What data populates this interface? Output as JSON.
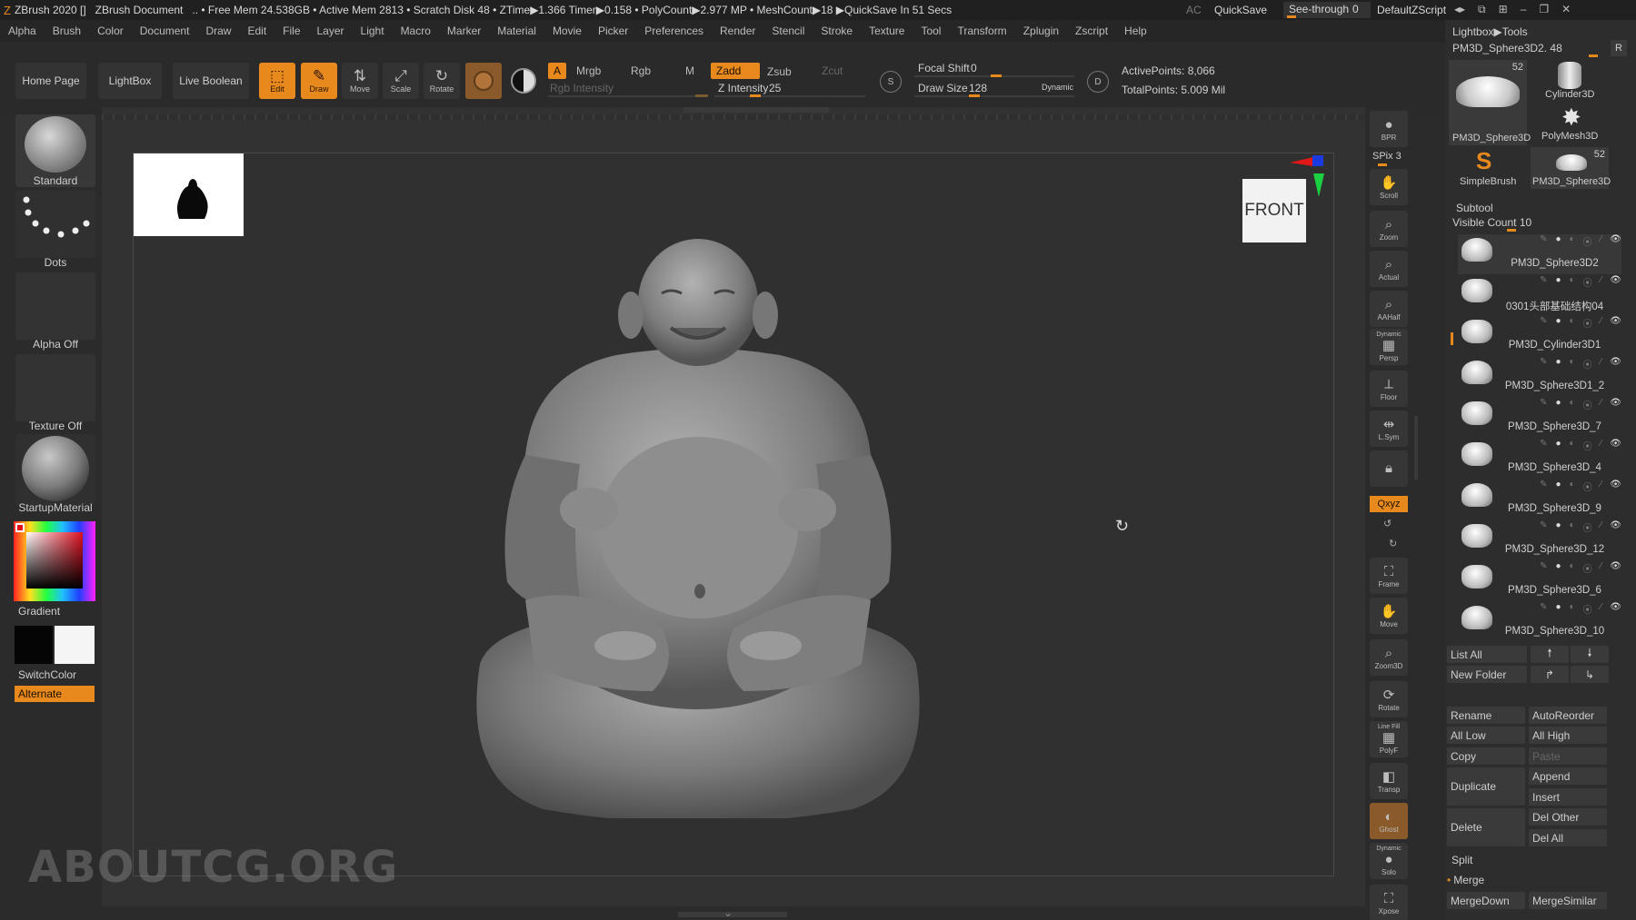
{
  "titlebar": {
    "app": "ZBrush 2020 []",
    "document": "ZBrush Document",
    "stats": ".. • Free Mem 24.538GB • Active Mem 2813 • Scratch Disk 48 • ZTime▶1.366 Timer▶0.158 • PolyCount▶2.977 MP • MeshCount▶18 ▶QuickSave In 51 Secs",
    "ac": "AC",
    "quicksave": "QuickSave",
    "seethrough": "See-through",
    "seethrough_value": "0",
    "script": "DefaultZScript"
  },
  "menubar": [
    "Alpha",
    "Brush",
    "Color",
    "Document",
    "Draw",
    "Edit",
    "File",
    "Layer",
    "Light",
    "Macro",
    "Marker",
    "Material",
    "Movie",
    "Picker",
    "Preferences",
    "Render",
    "Stencil",
    "Stroke",
    "Texture",
    "Tool",
    "Transform",
    "Zplugin",
    "Zscript",
    "Help"
  ],
  "toolbar": {
    "home_page": "Home Page",
    "lightbox": "LightBox",
    "live_boolean": "Live Boolean",
    "edit": "Edit",
    "draw": "Draw",
    "move": "Move",
    "scale": "Scale",
    "rotate": "Rotate",
    "a": "A",
    "mrgb": "Mrgb",
    "rgb": "Rgb",
    "m": "M",
    "zadd": "Zadd",
    "zsub": "Zsub",
    "zcut": "Zcut",
    "rgb_intensity": "Rgb Intensity",
    "z_intensity_label": "Z Intensity",
    "z_intensity": "25",
    "z_intensity_level": 0.25,
    "focal_shift_label": "Focal Shift",
    "focal_shift": "0",
    "draw_size_label": "Draw Size",
    "draw_size": "128",
    "dynamic": "Dynamic",
    "active_points": "ActivePoints: 8,066",
    "total_points": "TotalPoints: 5.009 Mil"
  },
  "leftpanel": {
    "brush": "Standard",
    "stroke": "Dots",
    "alpha": "Alpha Off",
    "texture": "Texture Off",
    "material": "StartupMaterial",
    "gradient": "Gradient",
    "switchcolor": "SwitchColor",
    "alternate": "Alternate"
  },
  "canvas": {
    "view_label": "FRONT",
    "watermark": "ABOUTCG.ORG"
  },
  "rightshelf": {
    "bpr": "BPR",
    "spix": "SPix 3",
    "scroll": "Scroll",
    "zoom": "Zoom",
    "actual": "Actual",
    "aahalf": "AAHalf",
    "dynamic": "Dynamic",
    "persp": "Persp",
    "floor": "Floor",
    "lsym": "L.Sym",
    "xyz": "Qxyz",
    "frame": "Frame",
    "move": "Move",
    "zoom3d": "Zoom3D",
    "rotate": "Rotate",
    "linefill": "Line Fill",
    "polyf": "PolyF",
    "transp": "Transp",
    "ghost": "Ghost",
    "dynamic2": "Dynamic",
    "solo": "Solo",
    "xpose": "Xpose"
  },
  "rightpanel": {
    "breadcrumb": "Lightbox▶Tools",
    "current_tool": "PM3D_Sphere3D2. 48",
    "r": "R",
    "tools": [
      {
        "name": "PM3D_Sphere3D",
        "badge": "52"
      },
      {
        "name": "Cylinder3D",
        "badge": ""
      },
      {
        "name": "PolyMesh3D",
        "badge": ""
      },
      {
        "name": "SimpleBrush",
        "badge": ""
      },
      {
        "name": "PM3D_Sphere3D",
        "badge": "52"
      }
    ],
    "subtool_header": "Subtool",
    "visible_count": "Visible Count 10",
    "subtools": [
      "PM3D_Sphere3D2",
      "0301头部基础结构04",
      "PM3D_Cylinder3D1",
      "PM3D_Sphere3D1_2",
      "PM3D_Sphere3D_7",
      "PM3D_Sphere3D_4",
      "PM3D_Sphere3D_9",
      "PM3D_Sphere3D_12",
      "PM3D_Sphere3D_6",
      "PM3D_Sphere3D_10"
    ],
    "list_all": "List All",
    "new_folder": "New Folder",
    "rename": "Rename",
    "autoreorder": "AutoReorder",
    "all_low": "All Low",
    "all_high": "All High",
    "copy": "Copy",
    "paste": "Paste",
    "duplicate": "Duplicate",
    "append": "Append",
    "insert": "Insert",
    "delete": "Delete",
    "del_other": "Del Other",
    "del_all": "Del All",
    "split": "Split",
    "merge": "Merge",
    "mergedown": "MergeDown",
    "mergesimilar": "MergeSimilar"
  },
  "colors": {
    "accent": "#e8891e",
    "background": "#2b2b2b"
  }
}
